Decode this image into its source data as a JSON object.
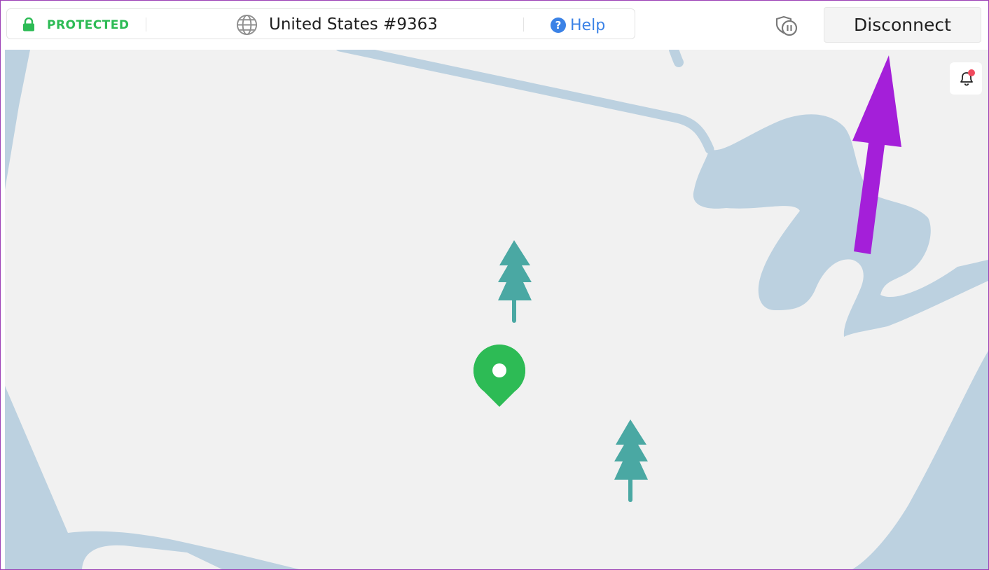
{
  "topbar": {
    "status_label": "PROTECTED",
    "server_name": "United States #9363",
    "help_label": "Help",
    "help_glyph": "?",
    "disconnect_label": "Disconnect"
  },
  "icons": {
    "lock": "lock-icon",
    "globe": "globe-icon",
    "help": "help-circle-icon",
    "pause": "shield-pause-icon",
    "notification": "bell-icon",
    "location": "map-pin-icon",
    "tree": "tree-icon"
  },
  "colors": {
    "protected": "#2dbb55",
    "link": "#3b82e6",
    "map_land": "#f1f1f1",
    "map_water": "#bcd1e0",
    "tree": "#4aa8a3",
    "pin": "#2dbb55",
    "annotation_arrow": "#a41fd9",
    "notification_dot": "#f04a5e"
  }
}
